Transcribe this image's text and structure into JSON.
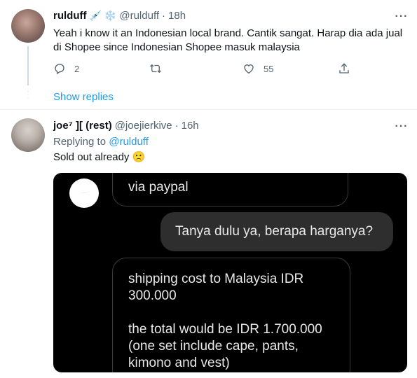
{
  "tweet1": {
    "name": "rulduff",
    "name_emojis": [
      "💉",
      "❄️"
    ],
    "handle": "@rulduff",
    "separator": "·",
    "time": "18h",
    "text": "Yeah i know it an Indonesian local brand. Cantik sangat. Harap dia ada jual di Shopee since Indonesian Shopee masuk malaysia",
    "actions": {
      "reply_count": "2",
      "retweet_count": "",
      "like_count": "55"
    },
    "more_label": "···"
  },
  "show_replies": "Show replies",
  "tweet2": {
    "name": "joe⁷ ][ (rest)",
    "handle": "@joejierkive",
    "separator": "·",
    "time": "16h",
    "replying_prefix": "Replying to",
    "replying_handle": "@rulduff",
    "text": "Sold out already 🙁",
    "more_label": "···",
    "media": {
      "bubble1_text": "via paypal",
      "bubble2_text": "Tanya dulu ya, berapa harganya?",
      "bubble3_text": "shipping cost to Malaysia IDR\n300.000\n\nthe total would be IDR 1.700.000\n(one set include cape, pants,\nkimono and vest)"
    }
  },
  "colors": {
    "accent": "#1d9bf0",
    "muted": "#536471",
    "text": "#0f1419"
  }
}
